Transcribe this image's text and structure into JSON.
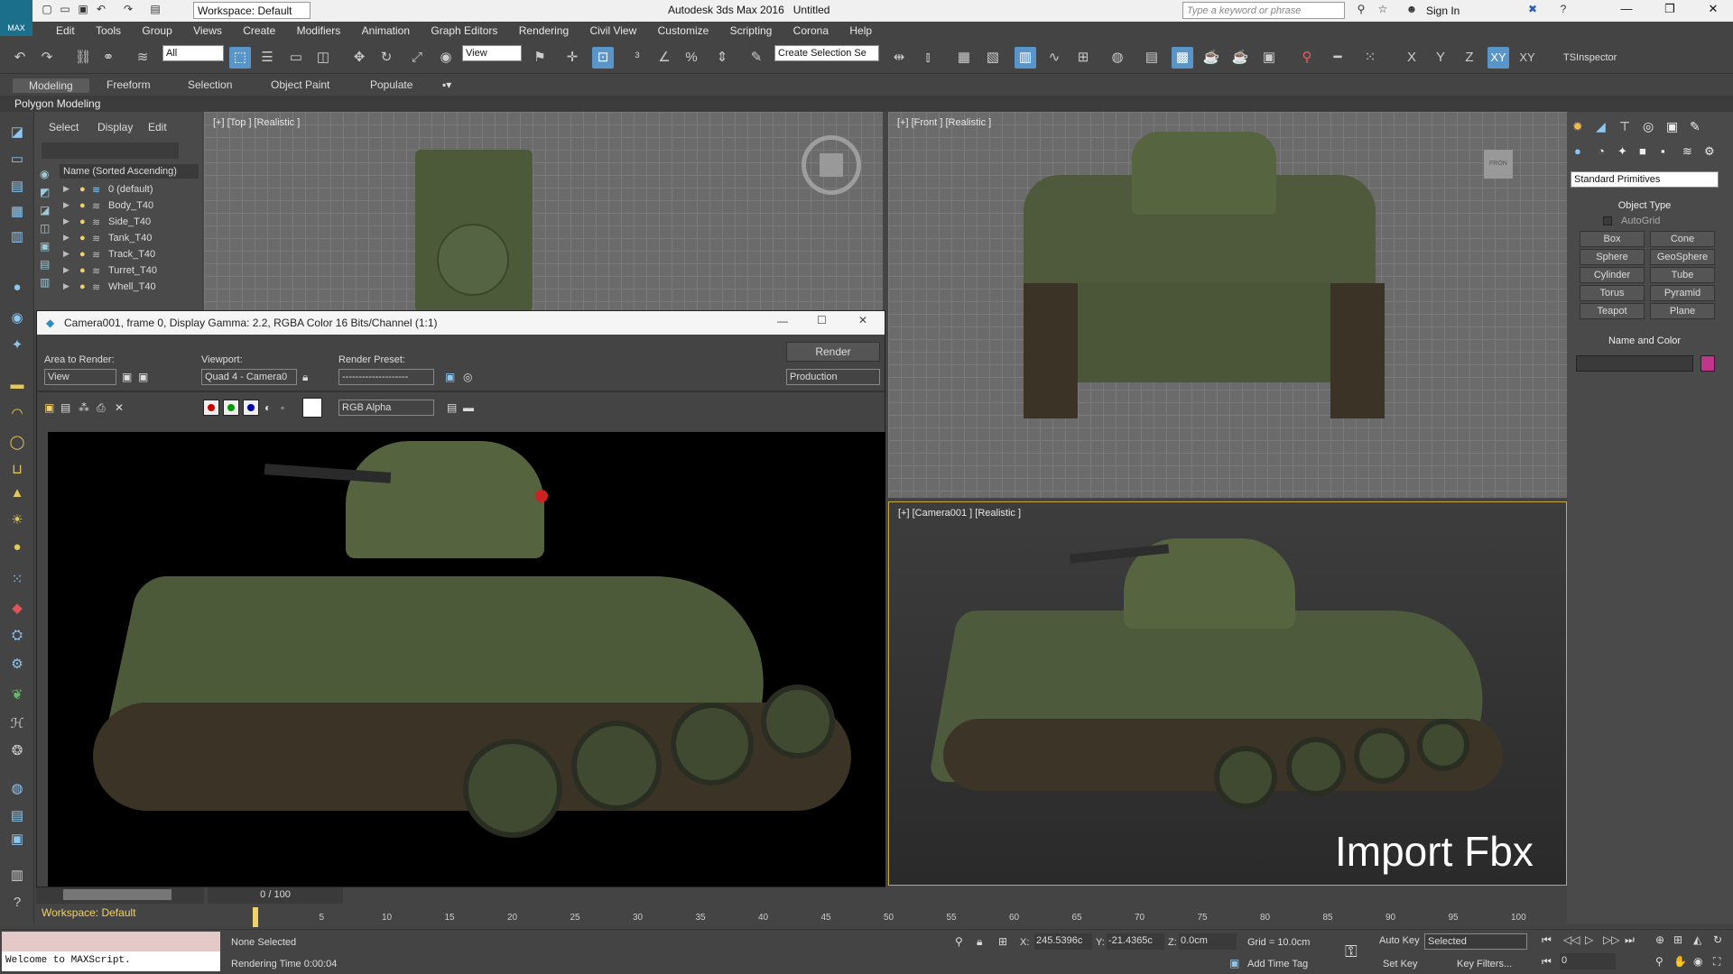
{
  "app": {
    "title": "Autodesk 3ds Max 2016",
    "doc": "Untitled",
    "logo_text": "MAX"
  },
  "workspace": {
    "label": "Workspace: Default"
  },
  "search": {
    "placeholder": "Type a keyword or phrase"
  },
  "signin": {
    "label": "Sign In"
  },
  "menu": [
    "Edit",
    "Tools",
    "Group",
    "Views",
    "Create",
    "Modifiers",
    "Animation",
    "Graph Editors",
    "Rendering",
    "Civil View",
    "Customize",
    "Scripting",
    "Corona",
    "Help"
  ],
  "toolbar": {
    "selection_filter": "All",
    "view_dropdown": "View",
    "selection_set": "Create Selection Se",
    "axes": [
      "X",
      "Y",
      "Z",
      "XY",
      "XY"
    ],
    "inspector": "TSInspector"
  },
  "ribbon": {
    "tabs": [
      "Modeling",
      "Freeform",
      "Selection",
      "Object Paint",
      "Populate"
    ],
    "sub": "Polygon Modeling"
  },
  "scene_explorer": {
    "tabs": [
      "Select",
      "Display",
      "Edit"
    ],
    "header": "Name (Sorted Ascending)",
    "rows": [
      "0 (default)",
      "Body_T40",
      "Side_T40",
      "Tank_T40",
      "Track_T40",
      "Turret_T40",
      "Whell_T40"
    ]
  },
  "viewports": {
    "top": "[+] [Top ] [Realistic ]",
    "front": "[+] [Front ] [Realistic ]",
    "camera": "[+] [Camera001 ] [Realistic ]",
    "viewcube_front": "FRON"
  },
  "render_window": {
    "title": "Camera001, frame 0, Display Gamma: 2.2, RGBA Color 16 Bits/Channel (1:1)",
    "area_label": "Area to Render:",
    "area_value": "View",
    "viewport_label": "Viewport:",
    "viewport_value": "Quad 4 - Camera0",
    "preset_label": "Render Preset:",
    "preset_value": "--------------------",
    "render_btn": "Render",
    "production": "Production",
    "channel": "RGB Alpha"
  },
  "command_panel": {
    "primitives": "Standard Primitives",
    "object_type": "Object Type",
    "autogrid": "AutoGrid",
    "buttons": [
      "Box",
      "Cone",
      "Sphere",
      "GeoSphere",
      "Cylinder",
      "Tube",
      "Torus",
      "Pyramid",
      "Teapot",
      "Plane"
    ],
    "name_color": "Name and Color",
    "swatch_color": "#c0368c"
  },
  "overlay": {
    "import_text": "Import Fbx"
  },
  "timeline": {
    "frame": "0 / 100",
    "ticks": [
      "5",
      "10",
      "15",
      "20",
      "25",
      "30",
      "35",
      "40",
      "45",
      "50",
      "55",
      "60",
      "65",
      "70",
      "75",
      "80",
      "85",
      "90",
      "95",
      "100"
    ],
    "workspace": "Workspace: Default"
  },
  "status": {
    "maxscript": "Welcome to MAXScript.",
    "selected": "None Selected",
    "render_time": "Rendering Time  0:00:04",
    "x": "245.5396c",
    "y": "-21.4365c",
    "z": "0.0cm",
    "grid": "Grid = 10.0cm",
    "add_time_tag": "Add Time Tag",
    "auto_key": "Auto Key",
    "set_key": "Set Key",
    "selected_dd": "Selected",
    "key_filters": "Key Filters...",
    "frame_field": "0"
  }
}
